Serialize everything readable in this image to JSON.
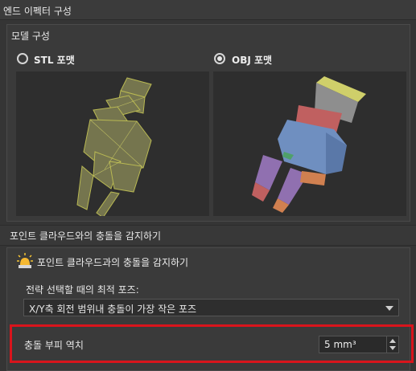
{
  "window": {
    "title": "엔드 이펙터 구성"
  },
  "model_config": {
    "title": "모델 구성",
    "options": [
      {
        "label": "STL 포맷",
        "checked": false
      },
      {
        "label": "OBJ 포맷",
        "checked": true
      }
    ]
  },
  "collision": {
    "section_title": "포인트 클라우드와의 충돌을 감지하기",
    "checkbox_label": "포인트 클라우드과의 충돌을 감지하기",
    "pose_label": "전략 선택할 때의 최적 포즈:",
    "pose_value": "X/Y축 회전 범위내 충돌이 가장 작은 포즈",
    "threshold_label": "충돌 부피 역치",
    "threshold_value": "5 mm³"
  },
  "colors": {
    "background": "#353535",
    "highlight_border": "#d9141c",
    "stl_model": "#b8b850",
    "obj_body": "#6f8fc0",
    "obj_top": "#cfcf6a",
    "obj_red": "#c06060",
    "obj_purple": "#9070b0",
    "obj_orange": "#d08050"
  },
  "icons": {
    "warning": "lamp-warning-icon",
    "combo_arrow": "chevron-down-icon",
    "spin_up": "spin-up-icon",
    "spin_down": "spin-down-icon"
  }
}
